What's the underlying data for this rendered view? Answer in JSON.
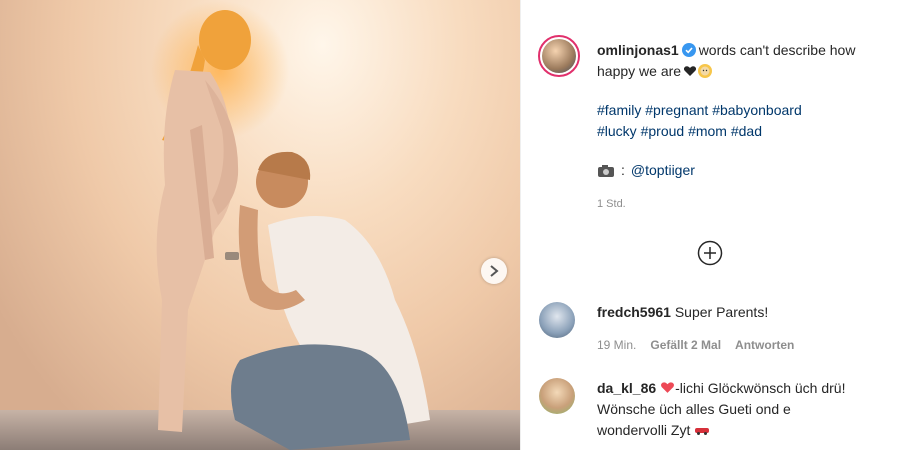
{
  "post": {
    "username": "omlinjonas1",
    "caption_text": "words can't describe how happy we are",
    "hashtags": [
      "#family",
      "#pregnant",
      "#babyonboard",
      "#lucky",
      "#proud",
      "#mom",
      "#dad"
    ],
    "credit_mention": "@toptiiger",
    "time_ago": "1 Std."
  },
  "comments": [
    {
      "username": "fredch5961",
      "text": "Super Parents!",
      "time": "19 Min.",
      "likes": "Gefällt 2 Mal",
      "reply_label": "Antworten"
    },
    {
      "username": "da_kl_86",
      "text": "-lichi Glöckwönsch üch drü! Wönsche üch alles Gueti ond e wondervolli Zyt"
    }
  ],
  "icons": {
    "verified": "verified-badge-icon",
    "carousel_next": "chevron-right-icon",
    "load_more": "plus-circle-icon",
    "camera": "camera-icon"
  },
  "colors": {
    "link": "#00376b",
    "verified": "#3897f0",
    "muted": "#8e8e8e",
    "heart": "#ed4956"
  }
}
